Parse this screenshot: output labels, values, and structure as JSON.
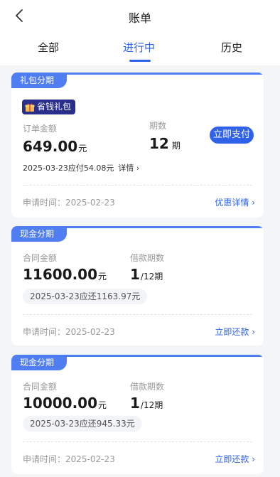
{
  "header": {
    "title": "账单"
  },
  "tabs": [
    {
      "label": "全部"
    },
    {
      "label": "进行中"
    },
    {
      "label": "历史"
    }
  ],
  "active_tab_index": 1,
  "accent": "#2f62e8",
  "cards": [
    {
      "tag": "礼包分期",
      "badge": "省钱礼包",
      "amount_label": "订单金额",
      "amount": "649.00",
      "amount_unit": "元",
      "period_label": "期数",
      "period": "12",
      "period_unit": "期",
      "action_button": "立即支付",
      "due_text": "2025-03-23应付54.08元",
      "due_detail": "详情 ›",
      "apply_time": "申请时间：2025-02-23",
      "link": "优惠详情 ›"
    },
    {
      "tag": "现金分期",
      "amount_label": "合同金额",
      "amount": "11600.00",
      "amount_unit": "元",
      "period_label": "借款期数",
      "period": "1",
      "period_unit": "/12期",
      "due_text": "2025-03-23应还1163.97元",
      "apply_time": "申请时间：2025-02-23",
      "link": "立即还款 ›"
    },
    {
      "tag": "现金分期",
      "amount_label": "合同金额",
      "amount": "10000.00",
      "amount_unit": "元",
      "period_label": "借款期数",
      "period": "1",
      "period_unit": "/12期",
      "due_text": "2025-03-23应还945.33元",
      "apply_time": "申请时间：2025-02-23",
      "link": "立即还款 ›"
    }
  ]
}
